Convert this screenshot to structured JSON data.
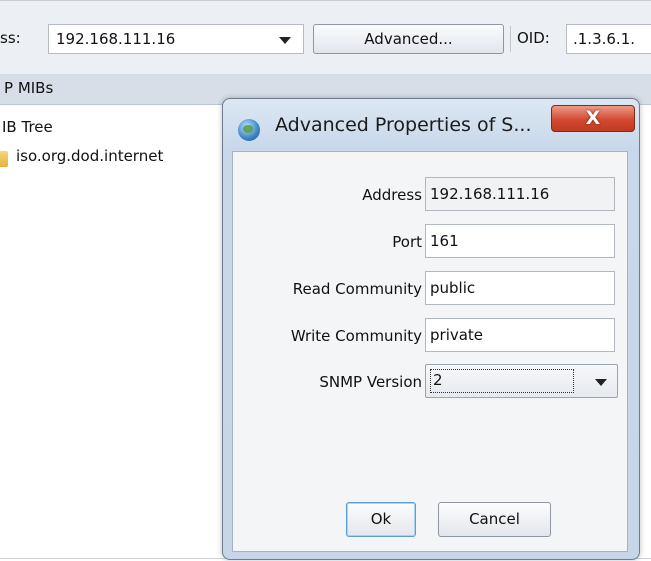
{
  "toolbar": {
    "address_label": "ss:",
    "address_value": "192.168.111.16",
    "advanced_button": "Advanced...",
    "oid_label": "OID:",
    "oid_value": ".1.3.6.1."
  },
  "mib_pane": {
    "header": "P MIBs",
    "tree_title": "IB Tree",
    "tree_item": "iso.org.dod.internet"
  },
  "dialog": {
    "title": "Advanced Properties of S...",
    "close_label": "X",
    "fields": {
      "address_label": "Address",
      "address_value": "192.168.111.16",
      "port_label": "Port",
      "port_value": "161",
      "read_community_label": "Read Community",
      "read_community_value": "public",
      "write_community_label": "Write Community",
      "write_community_value": "private",
      "snmp_version_label": "SNMP Version",
      "snmp_version_value": "2"
    },
    "ok_button": "Ok",
    "cancel_button": "Cancel"
  },
  "colors": {
    "dialog_frame": "#c6d6e8",
    "close_button": "#d24a32",
    "toolbar": "#eceff4"
  }
}
